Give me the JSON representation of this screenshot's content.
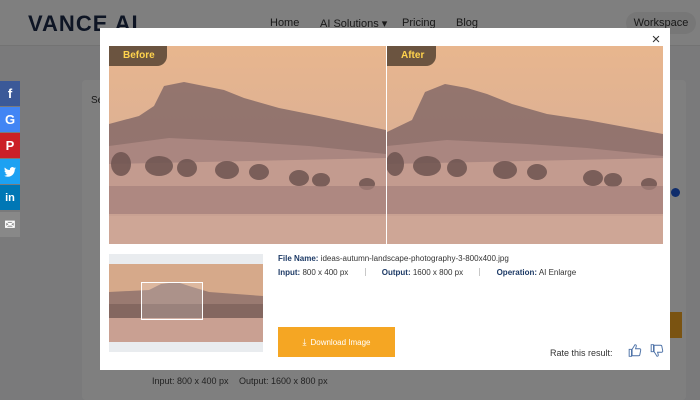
{
  "header": {
    "logo": "VANCE AI",
    "nav": [
      "Home",
      "AI Solutions ▾",
      "Pricing",
      "Blog"
    ],
    "workspace": "Workspace"
  },
  "background": {
    "card_title": "Se",
    "input_line": "Input: 800 x 400 px",
    "output_line": "Output: 1600 x 800 px"
  },
  "social": [
    {
      "name": "facebook-icon",
      "glyph": "f"
    },
    {
      "name": "google-icon",
      "glyph": "G"
    },
    {
      "name": "pinterest-icon",
      "glyph": "P"
    },
    {
      "name": "twitter-icon",
      "glyph": "✓"
    },
    {
      "name": "linkedin-icon",
      "glyph": "in"
    },
    {
      "name": "email-icon",
      "glyph": "✉"
    }
  ],
  "modal": {
    "close": "×",
    "before_label": "Before",
    "after_label": "After",
    "file_name_label": "File Name:",
    "file_name": "ideas-autumn-landscape-photography-3-800x400.jpg",
    "input_label": "Input:",
    "input_value": "800 x 400 px",
    "output_label": "Output:",
    "output_value": "1600 x 800 px",
    "operation_label": "Operation:",
    "operation_value": "AI Enlarge",
    "download_label": "Download Image",
    "rate_label": "Rate this result:"
  },
  "colors": {
    "accent": "#f5a623",
    "label_blue": "#1d3a66",
    "tag_bg": "#6b5440",
    "tag_text": "#ffd34d"
  }
}
